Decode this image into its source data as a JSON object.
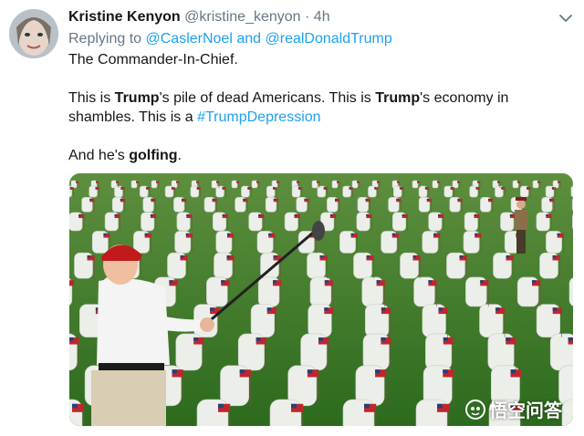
{
  "tweet": {
    "author_name": "Kristine Kenyon",
    "author_handle": "@kristine_kenyon",
    "separator": "·",
    "time": "4h",
    "reply_prefix": "Replying to",
    "reply_user1": "@CaslerNoel",
    "reply_and": "and",
    "reply_user2": "@realDonaldTrump",
    "line1": "The Commander-In-Chief.",
    "p2_a": "This is ",
    "p2_b": "Trump",
    "p2_c": "'s pile of dead Americans. This is ",
    "p2_d": "Trump",
    "p2_e": "'s economy in shambles. This is a ",
    "hashtag": "#TrumpDepression",
    "p3_a": "And he's ",
    "p3_b": "golfing",
    "p3_c": "."
  },
  "media": {
    "watermark_text": "悟空问答"
  },
  "icons": {
    "caret": "chevron-down-icon",
    "watermark_logo": "wukong-logo-icon"
  },
  "colors": {
    "link": "#1da1f2",
    "secondary": "#657786",
    "text": "#14171a"
  }
}
